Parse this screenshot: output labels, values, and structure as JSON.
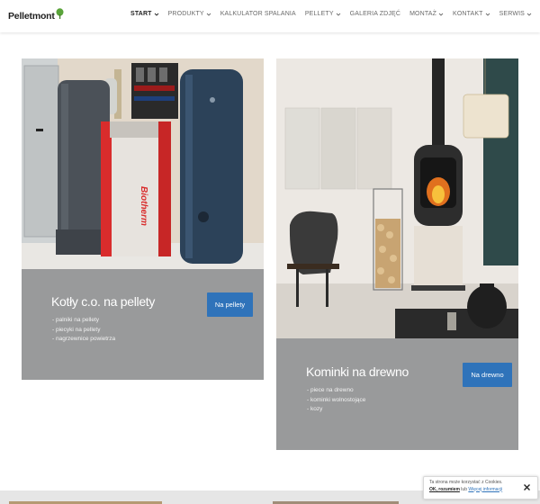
{
  "logo": {
    "text": "Pelletmont"
  },
  "nav": {
    "items": [
      {
        "label": "START",
        "dropdown": true,
        "active": true
      },
      {
        "label": "PRODUKTY",
        "dropdown": true
      },
      {
        "label": "KALKULATOR SPALANIA",
        "dropdown": false
      },
      {
        "label": "PELLETY",
        "dropdown": true
      },
      {
        "label": "GALERIA ZDJĘĆ",
        "dropdown": false
      },
      {
        "label": "MONTAŻ",
        "dropdown": true
      },
      {
        "label": "KONTAKT",
        "dropdown": true
      },
      {
        "label": "SERWIS",
        "dropdown": true
      }
    ]
  },
  "cards": [
    {
      "title": "Kotły c.o. na pellety",
      "button": "Na pellety",
      "list": [
        "- palniki na pellety",
        "- piecyki na pellety",
        "- nagrzewnice powietrza"
      ],
      "image_brand": "Biotherm"
    },
    {
      "title": "Kominki na drewno",
      "button": "Na drewno",
      "list": [
        "- piece na drewno",
        "- kominki wolnostojące",
        "- kozy"
      ]
    }
  ],
  "cookie": {
    "text": "Ta strona może korzystać z Cookies.",
    "ok": "OK, rozumiem",
    "or": "lub",
    "more": "Więcej informacji"
  },
  "colors": {
    "card_bg": "#999a9b",
    "button_bg": "#2f73ba",
    "boiler_red": "#d92c2c",
    "logo_leaf": "#5aa43a"
  }
}
